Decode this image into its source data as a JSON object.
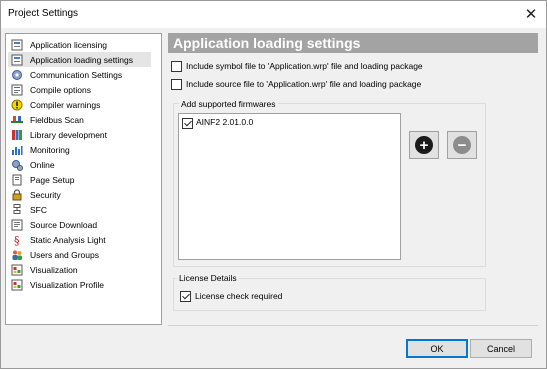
{
  "window": {
    "title": "Project Settings",
    "close_symbol": "✕"
  },
  "sidebar": {
    "items": [
      {
        "label": "Application licensing",
        "icon": "license-icon",
        "selected": false
      },
      {
        "label": "Application loading settings",
        "icon": "loading-settings-icon",
        "selected": true
      },
      {
        "label": "Communication Settings",
        "icon": "gear-icon",
        "selected": false
      },
      {
        "label": "Compile options",
        "icon": "compile-icon",
        "selected": false
      },
      {
        "label": "Compiler warnings",
        "icon": "warning-icon",
        "selected": false
      },
      {
        "label": "Fieldbus Scan",
        "icon": "fieldbus-icon",
        "selected": false
      },
      {
        "label": "Library development",
        "icon": "library-icon",
        "selected": false
      },
      {
        "label": "Monitoring",
        "icon": "monitoring-icon",
        "selected": false
      },
      {
        "label": "Online",
        "icon": "online-icon",
        "selected": false
      },
      {
        "label": "Page Setup",
        "icon": "page-setup-icon",
        "selected": false
      },
      {
        "label": "Security",
        "icon": "lock-icon",
        "selected": false
      },
      {
        "label": "SFC",
        "icon": "sfc-icon",
        "selected": false
      },
      {
        "label": "Source Download",
        "icon": "download-icon",
        "selected": false
      },
      {
        "label": "Static Analysis Light",
        "icon": "analysis-icon",
        "selected": false
      },
      {
        "label": "Users and Groups",
        "icon": "users-icon",
        "selected": false
      },
      {
        "label": "Visualization",
        "icon": "visualization-icon",
        "selected": false
      },
      {
        "label": "Visualization Profile",
        "icon": "visualization-profile-icon",
        "selected": false
      }
    ]
  },
  "main": {
    "header": "Application loading settings",
    "option_symbol_file": {
      "label": "Include symbol file to 'Application.wrp' file and loading package",
      "checked": false
    },
    "option_source_file": {
      "label": "Include source file to 'Application.wrp' file and loading package",
      "checked": false
    },
    "firmwares": {
      "group_label": "Add supported firmwares",
      "items": [
        {
          "label": "AINF2 2.01.0.0",
          "checked": true
        }
      ],
      "add_symbol": "+",
      "remove_symbol": "−"
    },
    "license": {
      "group_label": "License Details",
      "check_label": "License check required",
      "checked": true
    }
  },
  "footer": {
    "ok_label": "OK",
    "cancel_label": "Cancel"
  },
  "colors": {
    "header_bg": "#a3a3a3",
    "default_button_border": "#0078d7",
    "selected_item_bg": "#e5e5e5"
  }
}
